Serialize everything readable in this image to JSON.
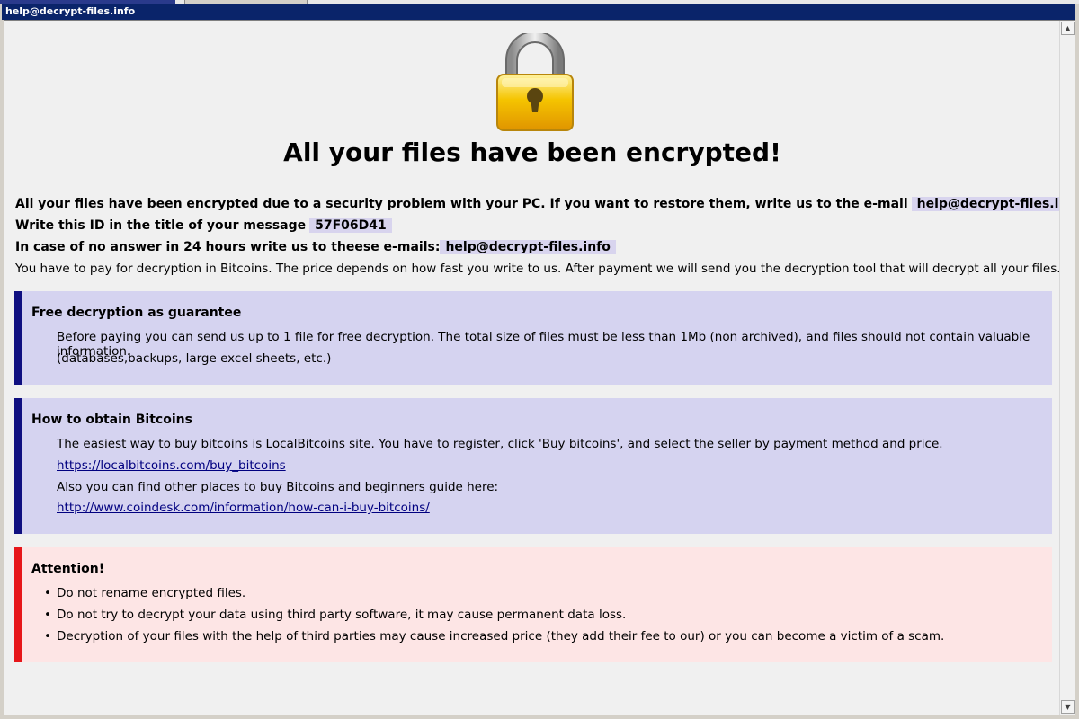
{
  "window": {
    "title": "help@decrypt-files.info"
  },
  "header": {
    "title": "All your files have been encrypted!"
  },
  "intro": {
    "line1_text": "All your files have been encrypted due to a security problem with your PC. If you want to restore them, write us to the e-mail",
    "line1_email": "help@decrypt-files.info",
    "line2_text": "Write this ID in the title of your message",
    "line2_id": "57F06D41",
    "line3_text": "In case of no answer in 24 hours write us to theese e-mails:",
    "line3_email": "help@decrypt-files.info",
    "line4_text": "You have to pay for decryption in Bitcoins. The price depends on how fast you write to us. After payment we will send you the decryption tool that will decrypt all your files."
  },
  "guarantee": {
    "heading": "Free decryption as guarantee",
    "line1": "Before paying you can send us up to 1 file for free decryption. The total size of files must be less than 1Mb (non archived), and files should not contain valuable information.",
    "line2": "(databases,backups, large excel sheets, etc.)"
  },
  "bitcoins": {
    "heading": "How to obtain Bitcoins",
    "line1": "The easiest way to buy bitcoins is LocalBitcoins site. You have to register, click 'Buy bitcoins', and select the seller by payment method and price.",
    "link1": "https://localbitcoins.com/buy_bitcoins",
    "line2": "Also you can find other places to buy Bitcoins and beginners guide here:",
    "link2": "http://www.coindesk.com/information/how-can-i-buy-bitcoins/"
  },
  "attention": {
    "heading": "Attention!",
    "items": [
      "Do not rename encrypted files.",
      "Do not try to decrypt your data using third party software, it may cause permanent data loss.",
      "Decryption of your files with the help of third parties may cause increased price (they add their fee to our) or you can become a victim of a scam."
    ]
  },
  "colors": {
    "titlebar": "#0a246a",
    "blue_box": "#d5d3f0",
    "blue_accent": "#0f0f80",
    "red_box": "#fde5e5",
    "red_accent": "#e6161a",
    "highlight": "#d8d4ee"
  },
  "icons": {
    "lock": "padlock-icon",
    "scroll_up": "arrow-up-icon",
    "scroll_down": "arrow-down-icon"
  }
}
